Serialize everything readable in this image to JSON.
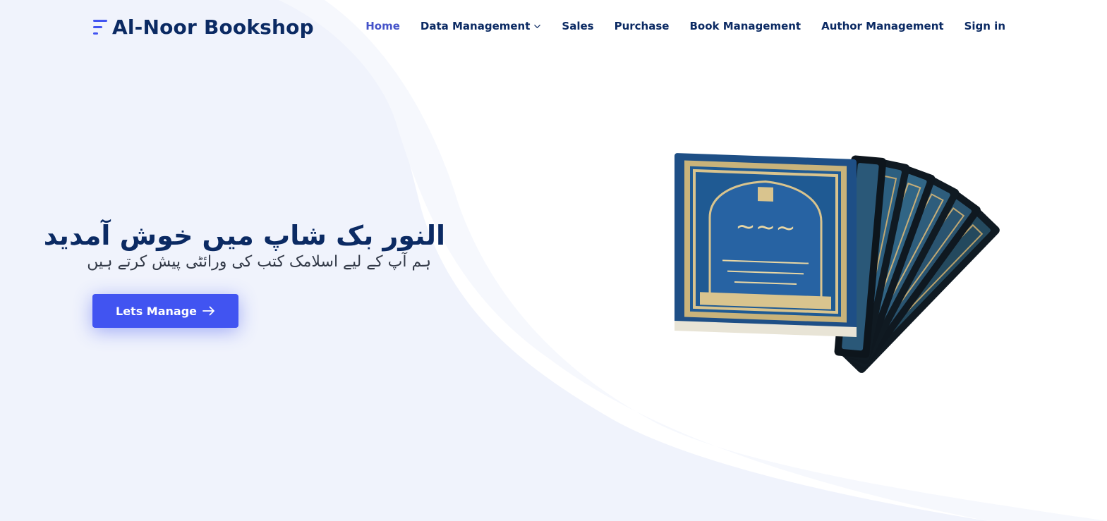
{
  "brand": {
    "name": "Al-Noor Bookshop",
    "logo_icon": "menu-lines-icon"
  },
  "nav": {
    "items": [
      {
        "label": "Home",
        "active": true
      },
      {
        "label": "Data Management",
        "has_dropdown": true
      },
      {
        "label": "Sales"
      },
      {
        "label": "Purchase"
      },
      {
        "label": "Book Management"
      },
      {
        "label": "Author Management"
      },
      {
        "label": "Sign in"
      }
    ]
  },
  "hero": {
    "title": "النور بک شاپ میں خوش آمدید",
    "subtitle": "ہم آپ کے لیے اسلامک کتب کی ورائٹی پیش کرتے ہیں",
    "cta_label": "Lets Manage",
    "cta_icon": "arrow-right-icon",
    "image": "stack-of-islamic-books-illustration"
  },
  "colors": {
    "primary": "#4154f1",
    "heading": "#0b2a63",
    "nav_active": "#4553c9",
    "background_tint": "#f1f4fd"
  }
}
